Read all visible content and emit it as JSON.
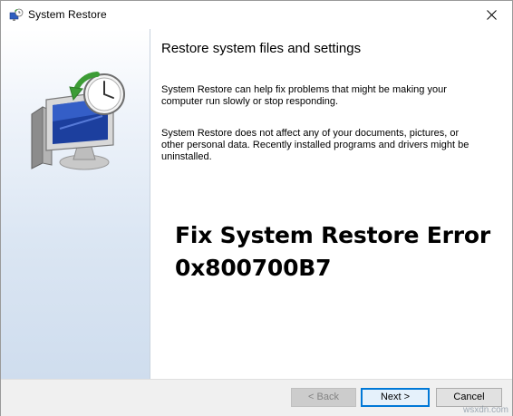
{
  "window": {
    "title": "System Restore",
    "close_glyph": "✕"
  },
  "sidebar": {
    "icon": "system-restore-icon"
  },
  "content": {
    "heading": "Restore system files and settings",
    "paragraph_1": "System Restore can help fix problems that might be making your computer run slowly or stop responding.",
    "paragraph_2": "System Restore does not affect any of your documents, pictures, or other personal data. Recently installed programs and drivers might be uninstalled.",
    "overlay_line_1": "Fix System Restore Error",
    "overlay_line_2": "0x800700B7"
  },
  "buttons": {
    "back": "< Back",
    "next": "Next >",
    "cancel": "Cancel",
    "back_enabled": false
  },
  "watermark": "wsxdn.com",
  "colors": {
    "accent": "#0078d7",
    "sidebar_gradient_end": "#cfddee"
  }
}
